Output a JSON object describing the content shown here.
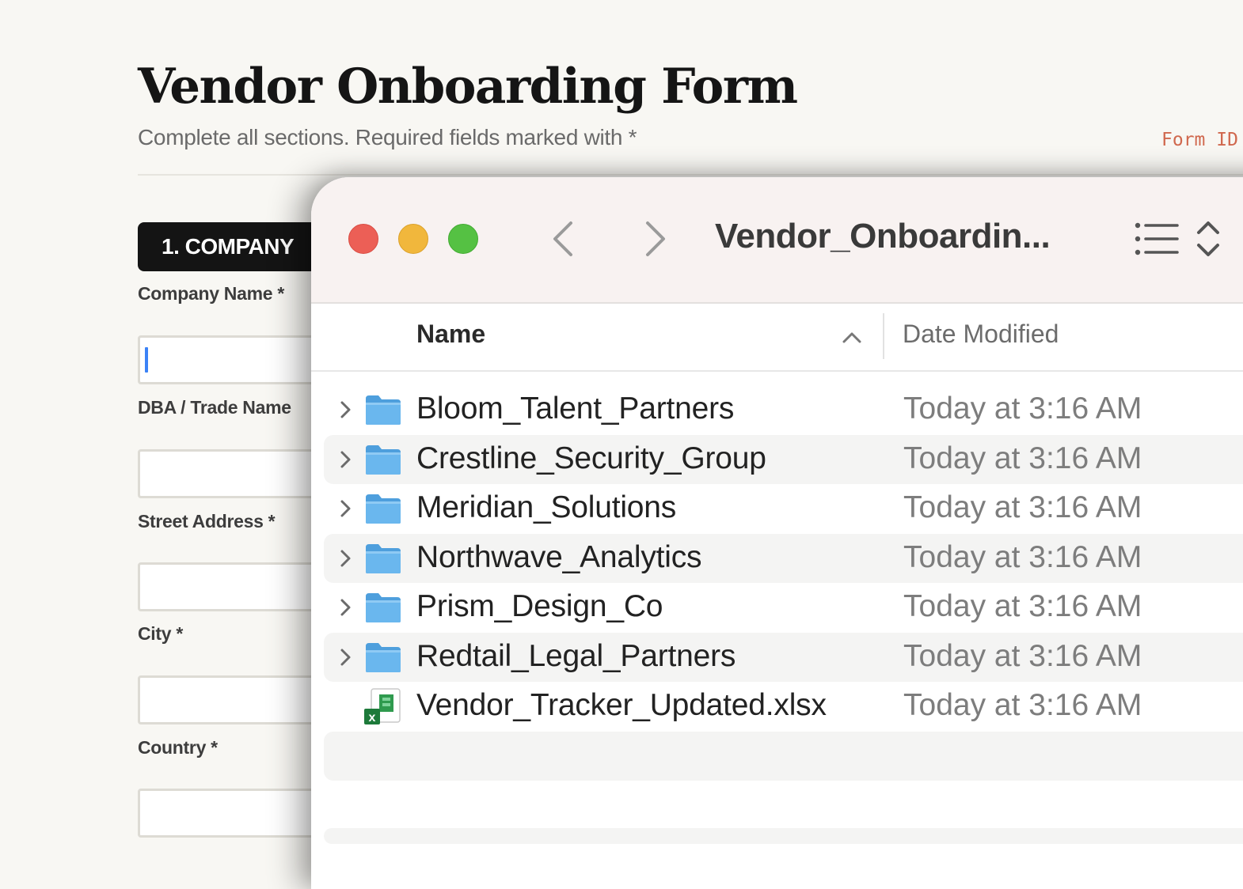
{
  "form": {
    "title": "Vendor Onboarding Form",
    "subtitle": "Complete all sections. Required fields marked with *",
    "form_id_label": "Form ID",
    "section_header": "1. COMPANY",
    "fields": [
      {
        "label": "Company Name *",
        "value": ""
      },
      {
        "label": "DBA / Trade Name",
        "value": ""
      },
      {
        "label": "Street Address *",
        "value": ""
      },
      {
        "label": "City *",
        "value": ""
      },
      {
        "label": "Country *",
        "value": ""
      }
    ]
  },
  "finder": {
    "window_title": "Vendor_Onboardin...",
    "columns": {
      "name": "Name",
      "date_modified": "Date Modified"
    },
    "sort": {
      "column": "Name",
      "direction": "ascending"
    },
    "items": [
      {
        "name": "Bloom_Talent_Partners",
        "date": "Today at 3:16 AM",
        "kind": "folder"
      },
      {
        "name": "Crestline_Security_Group",
        "date": "Today at 3:16 AM",
        "kind": "folder"
      },
      {
        "name": "Meridian_Solutions",
        "date": "Today at 3:16 AM",
        "kind": "folder"
      },
      {
        "name": "Northwave_Analytics",
        "date": "Today at 3:16 AM",
        "kind": "folder"
      },
      {
        "name": "Prism_Design_Co",
        "date": "Today at 3:16 AM",
        "kind": "folder"
      },
      {
        "name": "Redtail_Legal_Partners",
        "date": "Today at 3:16 AM",
        "kind": "folder"
      },
      {
        "name": "Vendor_Tracker_Updated.xlsx",
        "date": "Today at 3:16 AM",
        "kind": "xlsx"
      }
    ]
  },
  "icons": {
    "traffic_lights": [
      "close-icon",
      "minimize-icon",
      "maximize-icon"
    ],
    "nav": [
      "back-icon",
      "forward-icon"
    ],
    "view": [
      "list-view-icon",
      "view-options-chevron-icon"
    ],
    "sort": "chevron-up-icon",
    "folder": "folder-icon",
    "spreadsheet": "excel-file-icon",
    "disclosure": "chevron-right-icon"
  },
  "colors": {
    "accent_form_id": "#d0684e",
    "section_header_bg": "#141414",
    "folder_blue": "#6ab7ee",
    "caret_blue": "#3b82f6",
    "close": "#ec5f56",
    "minimize": "#f1b73c",
    "maximize": "#55c143"
  }
}
